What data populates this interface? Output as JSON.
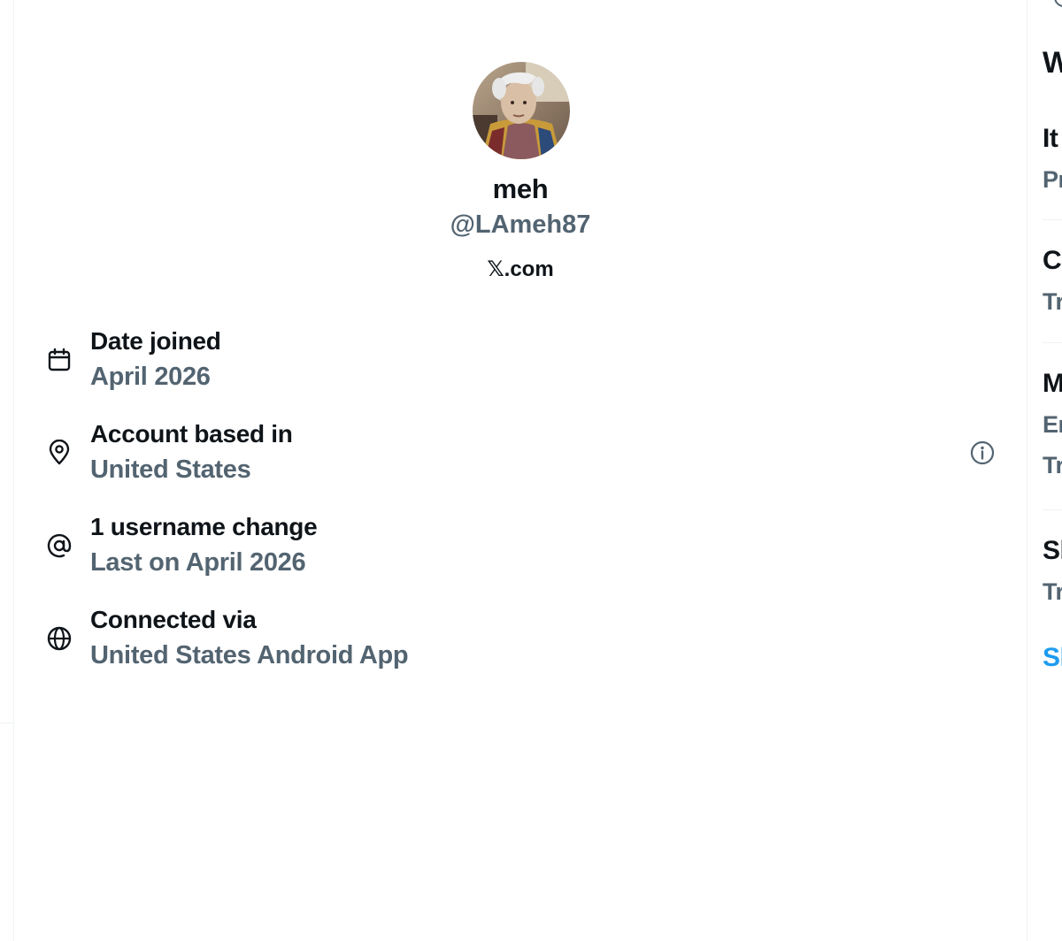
{
  "profile": {
    "display_name": "meh",
    "handle": "@LAmeh87",
    "source": "𝕏.com",
    "avatar_icon": "profile-avatar"
  },
  "about": {
    "date_joined": {
      "title": "Date joined",
      "value": "April 2026",
      "icon": "calendar-icon"
    },
    "based_in": {
      "title": "Account based in",
      "value": "United States",
      "icon": "location-pin-icon",
      "info_icon": "info-icon"
    },
    "username_changes": {
      "title": "1 username change",
      "value": "Last on April 2026",
      "icon": "at-sign-icon"
    },
    "connected_via": {
      "title": "Connected via",
      "value": "United States Android App",
      "icon": "globe-icon"
    }
  },
  "sidebar": {
    "heading": "W",
    "items": [
      {
        "title": "It",
        "sub": "Pr"
      },
      {
        "title": "C",
        "sub": "Tr"
      },
      {
        "title": "M",
        "sub": "Er",
        "sub2": "Tr"
      },
      {
        "title": "Sl",
        "sub": "Tr"
      }
    ],
    "show_more": "Sl"
  },
  "colors": {
    "primary_text": "#0f1419",
    "secondary_text": "#536471",
    "link": "#1d9bf0",
    "border": "#eff3f4"
  }
}
